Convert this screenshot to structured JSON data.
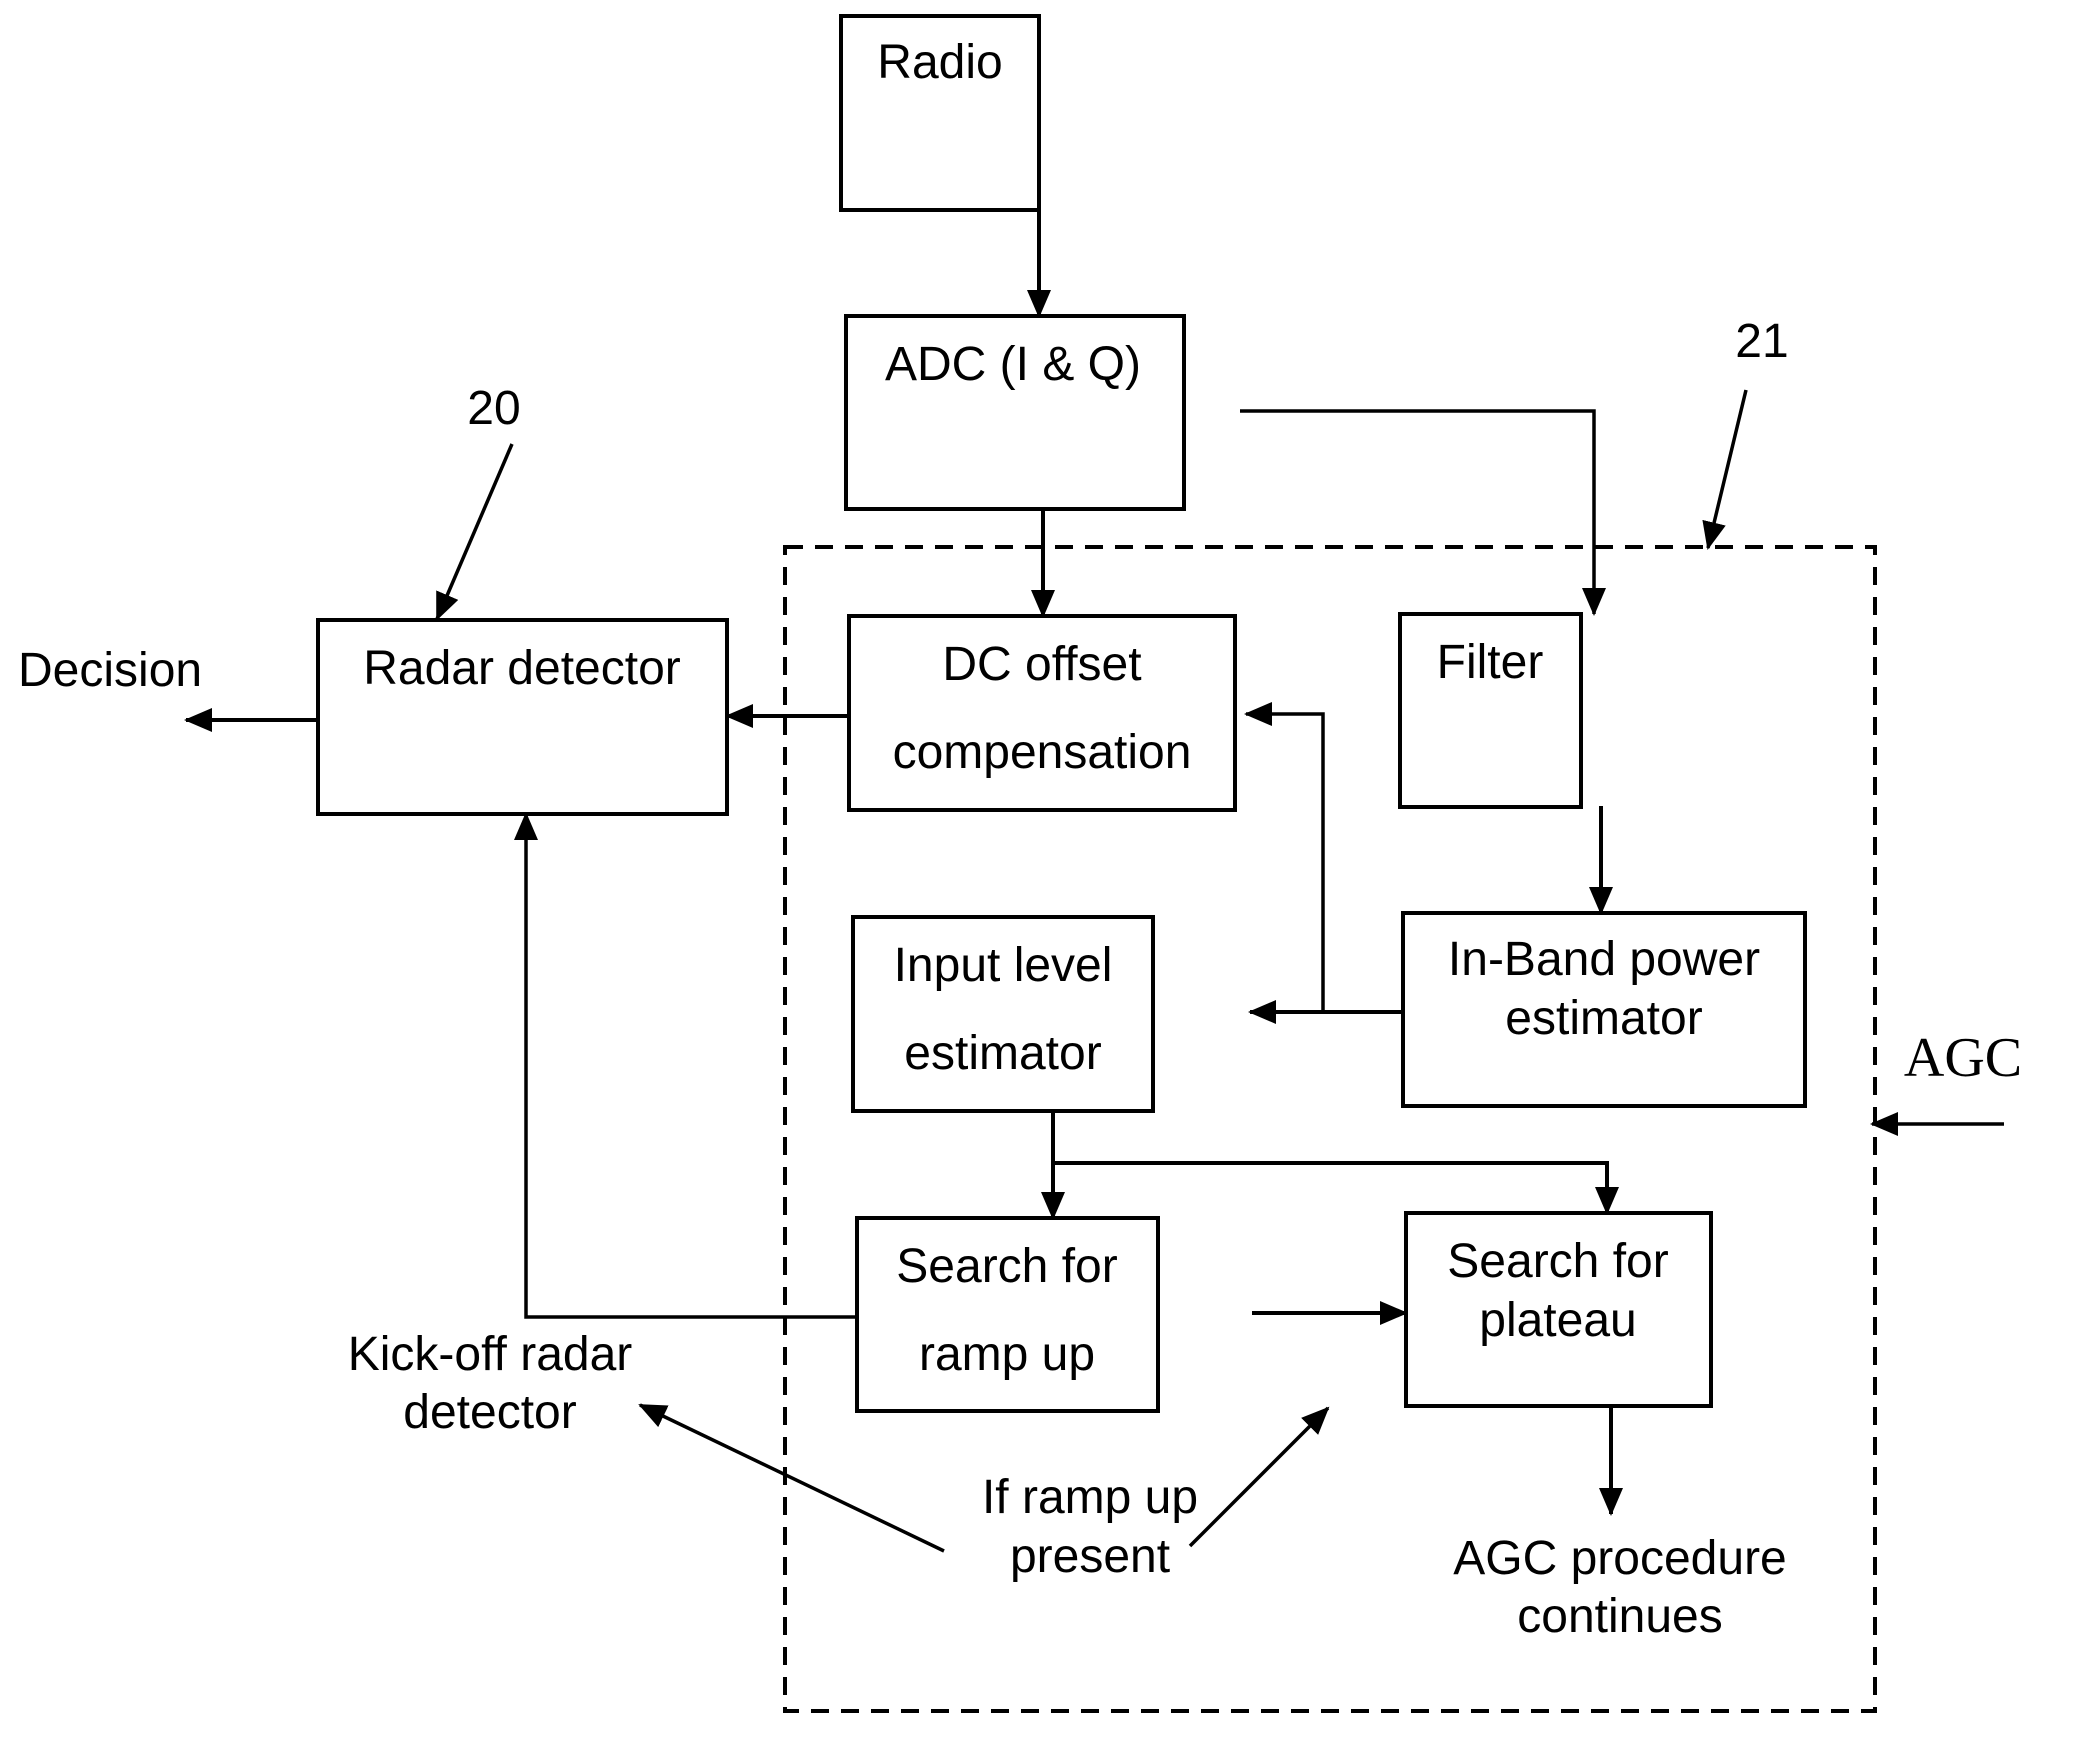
{
  "diagram": {
    "blocks": {
      "radio": {
        "label": "Radio"
      },
      "adc": {
        "label": "ADC (I & Q)"
      },
      "radar_detector": {
        "label": "Radar detector",
        "ref": "20"
      },
      "dc_offset": {
        "line1": "DC offset",
        "line2": "compensation"
      },
      "filter": {
        "label": "Filter"
      },
      "input_level": {
        "line1": "Input level",
        "line2": "estimator"
      },
      "in_band": {
        "line1": "In-Band power",
        "line2": "estimator"
      },
      "search_ramp": {
        "line1": "Search for",
        "line2": "ramp up"
      },
      "search_plateau": {
        "line1": "Search for",
        "line2": "plateau"
      }
    },
    "agc_region": {
      "label": "AGC",
      "ref": "21"
    },
    "labels": {
      "decision": "Decision",
      "kickoff_line1": "Kick-off radar",
      "kickoff_line2": "detector",
      "if_ramp_line1": "If ramp up",
      "if_ramp_line2": "present",
      "agc_continues_line1": "AGC procedure",
      "agc_continues_line2": "continues"
    }
  }
}
